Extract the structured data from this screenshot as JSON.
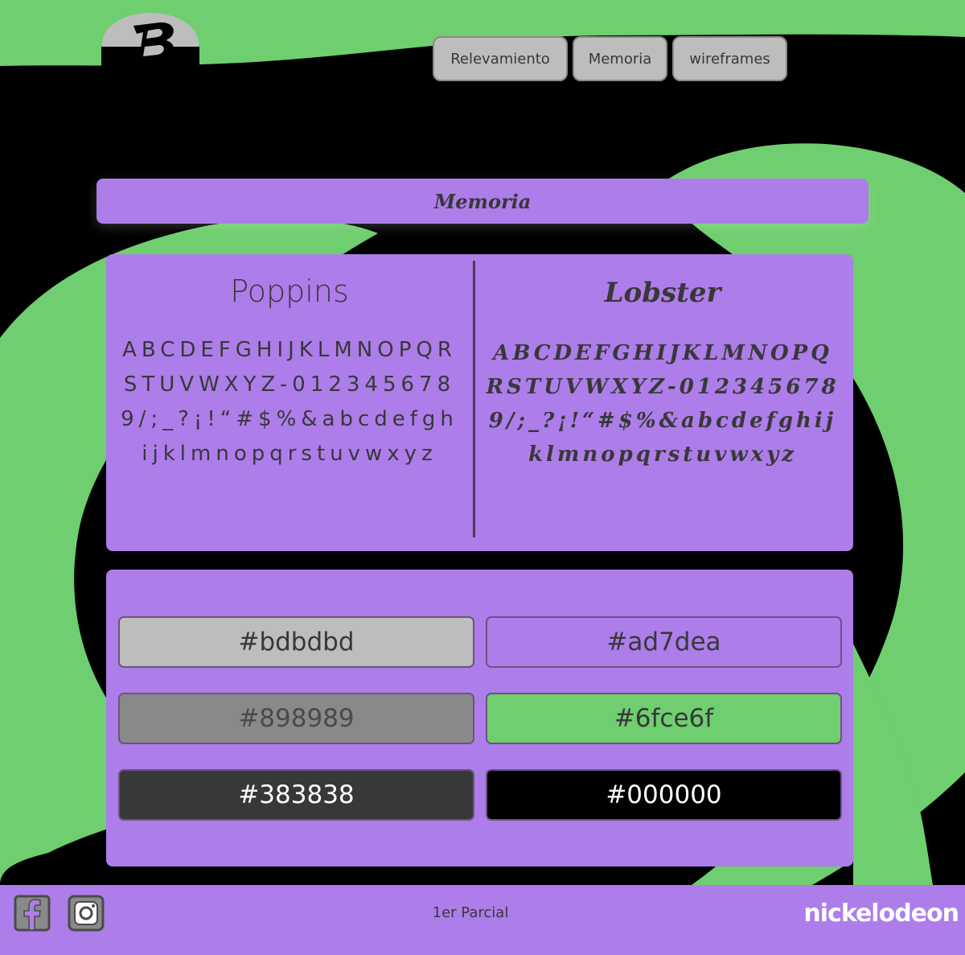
{
  "colors": {
    "background": "#000000",
    "accent_green": "#6fce6f",
    "accent_purple": "#ad7dea",
    "gray_light": "#bdbdbd",
    "gray_mid": "#898989",
    "gray_dark": "#383838"
  },
  "header": {
    "logo_icon": "bs-logo-icon",
    "nav": [
      {
        "label": "Relevamiento"
      },
      {
        "label": "Memoria"
      },
      {
        "label": "wireframes"
      }
    ]
  },
  "main": {
    "title": "Memoria",
    "fonts": [
      {
        "name": "Poppins",
        "glyphs": "ABCDEFGHIJKLMNOPQRSTUVWXYZ-0123456789/;_?¡!“#$%&abcdefghijklmnopqrstuvwxyz"
      },
      {
        "name": "Lobster",
        "glyphs": "ABCDEFGHIJKLMNOPQRSTUVWXYZ-0123456789/;_?¡!“#$%&abcdefghijklmnopqrstuvwxyz"
      }
    ],
    "swatches": [
      {
        "label": "#bdbdbd",
        "bg": "#bdbdbd",
        "fg": "#383838"
      },
      {
        "label": "#ad7dea",
        "bg": "#ad7dea",
        "fg": "#383838"
      },
      {
        "label": "#898989",
        "bg": "#898989",
        "fg": "#4a4a4a"
      },
      {
        "label": "#6fce6f",
        "bg": "#6fce6f",
        "fg": "#383838"
      },
      {
        "label": "#383838",
        "bg": "#383838",
        "fg": "#ffffff"
      },
      {
        "label": "#000000",
        "bg": "#000000",
        "fg": "#ffffff"
      }
    ]
  },
  "footer": {
    "social_icons": [
      "facebook-icon",
      "instagram-icon"
    ],
    "text": "1er Parcial",
    "brand": "nickelodeon"
  }
}
